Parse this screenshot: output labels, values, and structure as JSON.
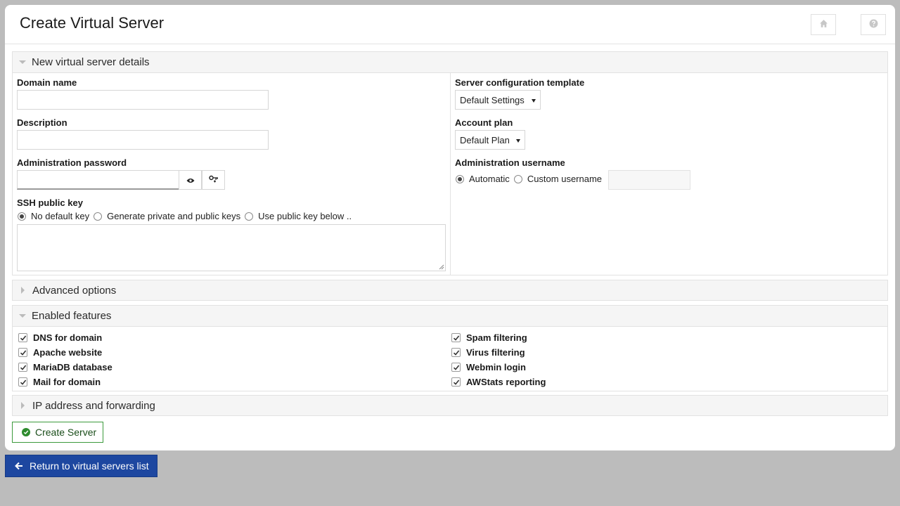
{
  "header": {
    "title": "Create Virtual Server",
    "home_icon": "home-icon",
    "help_icon": "help-icon"
  },
  "details": {
    "title": "New virtual server details",
    "domain_name": {
      "label": "Domain name",
      "value": ""
    },
    "description": {
      "label": "Description",
      "value": ""
    },
    "admin_password": {
      "label": "Administration password",
      "value": ""
    },
    "ssh_key": {
      "label": "SSH public key",
      "options": [
        "No default key",
        "Generate private and public keys",
        "Use public key below .."
      ],
      "selected": 0,
      "value": ""
    },
    "template": {
      "label": "Server configuration template",
      "value": "Default Settings"
    },
    "plan": {
      "label": "Account plan",
      "value": "Default Plan"
    },
    "admin_username": {
      "label": "Administration username",
      "options": [
        "Automatic",
        "Custom username"
      ],
      "selected": 0,
      "custom_value": ""
    }
  },
  "advanced": {
    "title": "Advanced options"
  },
  "features": {
    "title": "Enabled features",
    "left": [
      "DNS for domain",
      "Apache website",
      "MariaDB database",
      "Mail for domain"
    ],
    "right": [
      "Spam filtering",
      "Virus filtering",
      "Webmin login",
      "AWStats reporting"
    ]
  },
  "ip": {
    "title": "IP address and forwarding"
  },
  "actions": {
    "create_label": "Create Server",
    "return_label": "Return to virtual servers list"
  },
  "colors": {
    "background": "#bcbcbc",
    "create_border": "#3c9a3c",
    "return_bg": "#1d47a0"
  }
}
